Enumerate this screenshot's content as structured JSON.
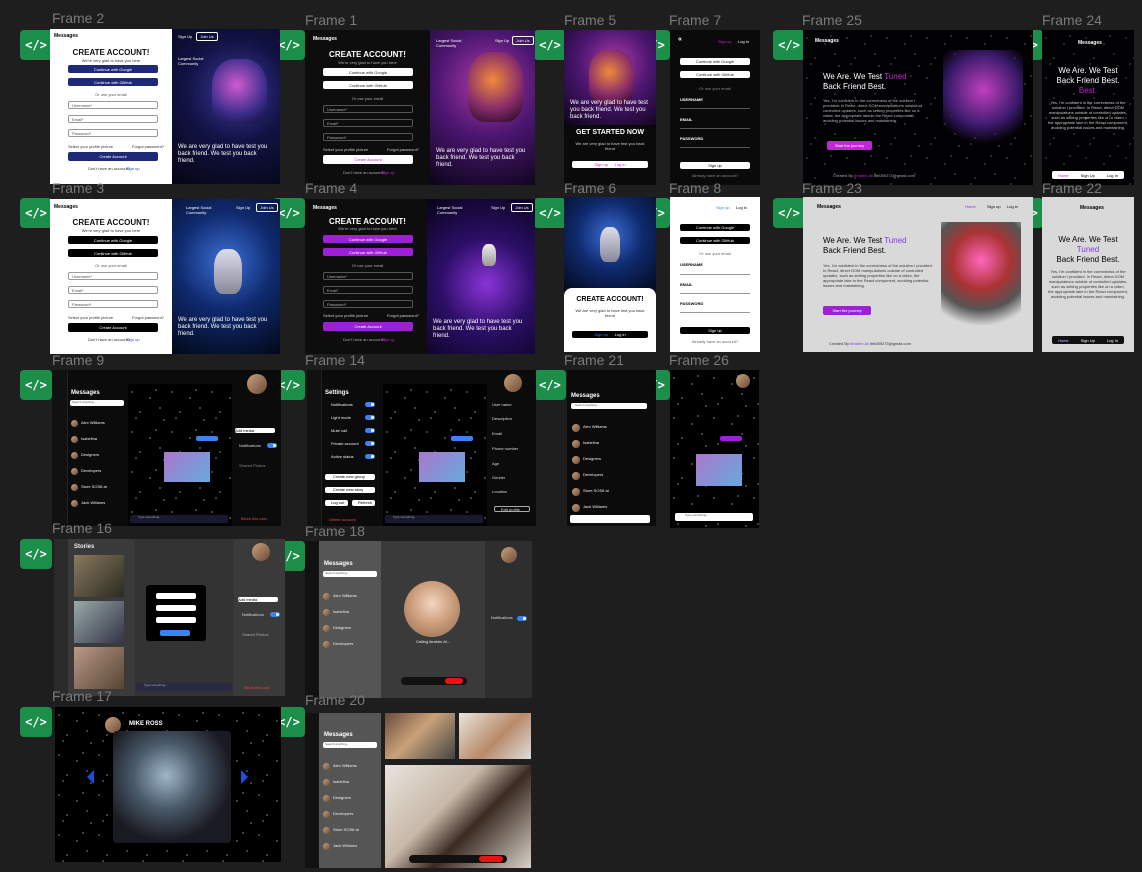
{
  "frames": {
    "f2": {
      "label": "Frame 2"
    },
    "f1": {
      "label": "Frame 1"
    },
    "f5": {
      "label": "Frame 5"
    },
    "f7": {
      "label": "Frame 7"
    },
    "f25": {
      "label": "Frame 25"
    },
    "f24": {
      "label": "Frame 24"
    },
    "f3": {
      "label": "Frame 3"
    },
    "f4": {
      "label": "Frame 4"
    },
    "f6": {
      "label": "Frame 6"
    },
    "f8": {
      "label": "Frame 8"
    },
    "f23": {
      "label": "Frame 23"
    },
    "f22": {
      "label": "Frame 22"
    },
    "f9": {
      "label": "Frame 9"
    },
    "f14": {
      "label": "Frame 14"
    },
    "f21": {
      "label": "Frame 21"
    },
    "f26": {
      "label": "Frame 26"
    },
    "f16": {
      "label": "Frame 16"
    },
    "f18": {
      "label": "Frame 18"
    },
    "f17": {
      "label": "Frame 17"
    },
    "f20": {
      "label": "Frame 20"
    }
  },
  "code_icon": "</>",
  "auth": {
    "brand": "Messages",
    "create_account": "CREATE ACCOUNT!",
    "subtitle": "We're very glad to have you here",
    "google": "Continue with Google",
    "github": "Continue with GitHub",
    "or_email": "Or use your email",
    "username": "Username*",
    "email": "Email*",
    "password": "Password*",
    "profile": "Select your profile picture",
    "forgot": "Forgot password?",
    "create_btn": "Create Account",
    "have_account": "Don't have an account?",
    "signup_link": "Sign up",
    "sign_up": "Sign Up",
    "join_us": "Join Us",
    "quote": "We are very glad to have test you back friend. We test you back friend.",
    "community": "Largest Social Community",
    "get_started": "GET STARTED NOW",
    "get_started_sub": "We are very glad to have test you back friend",
    "sign_up_small": "Sign up",
    "log_in": "Log in",
    "username_caps": "USERNAME",
    "email_caps": "EMAIL",
    "password_caps": "PASSWORD",
    "already": "Already have an account?"
  },
  "landing": {
    "brand": "Messages",
    "headline_1": "We Are. We Test",
    "headline_accent": "Tuned",
    "headline_2": "Back Friend Best.",
    "headline_accent_2": "Best.",
    "body": "Yes, I'm confident in the correctness of the solution I provided. In React, direct DOM manipulations outside of controlled updates, such as setting properties like on a video, the appropriate lake in the React component, avoiding potential issues and maintaining.",
    "cta": "Start the journey",
    "footer": "Created By",
    "author": "Ibrahim Ali",
    "email": "ibb089273@gmail.com",
    "home": "Home",
    "sign_up": "Sign Up",
    "log_in": "Log In",
    "sign_up_lower": "Sign up",
    "log_in_lower": "Log in"
  },
  "chat": {
    "messages_title": "Messages",
    "search": "Search anything...",
    "settings_title": "Settings",
    "stories_title": "Stories",
    "contacts": [
      {
        "name": "Alex Williams"
      },
      {
        "name": "Isabelina"
      },
      {
        "name": "Designers"
      },
      {
        "name": "Developers"
      },
      {
        "name": "Store SOS8 at"
      },
      {
        "name": "Jack Williams"
      }
    ],
    "type_placeholder": "Type something...",
    "notifications": "Notifications",
    "light_mode": "Light mode",
    "mute_call": "Mute call",
    "private_account": "Private account",
    "active_status": "Active status",
    "create_group": "Create new group",
    "create_story": "Create new story",
    "logout": "Log out",
    "refresh": "Refresh",
    "delete_account": "Delete account",
    "username": "User name",
    "description": "Description",
    "email": "Email",
    "phone": "Phone number",
    "age": "Age",
    "gender": "Gender",
    "location": "Location",
    "edit_profile": "Edit profile",
    "calling": "Calling ibrahim Al...",
    "mike_ross": "MIKE ROSS",
    "notif_label": "Notifications",
    "add_media": "Add media",
    "shared_photos": "Shared Photos",
    "block_user": "Block this user"
  }
}
